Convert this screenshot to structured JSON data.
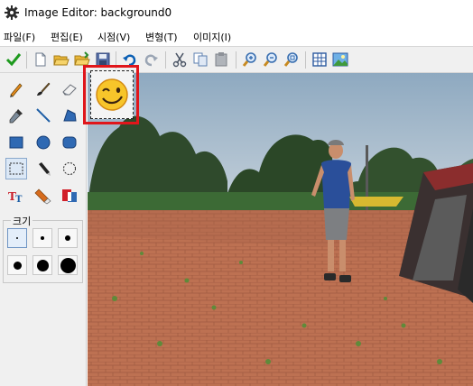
{
  "window": {
    "title": "Image Editor: background0",
    "app_icon": "gear-icon"
  },
  "menu": [
    {
      "label": "파일(F)"
    },
    {
      "label": "편집(E)"
    },
    {
      "label": "시점(V)"
    },
    {
      "label": "변형(T)"
    },
    {
      "label": "이미지(I)"
    }
  ],
  "toolbar": [
    "check-icon",
    "new-file-icon",
    "open-folder-icon",
    "open-folder-2-icon",
    "save-icon",
    "undo-icon",
    "redo-icon",
    "cut-icon",
    "copy-icon",
    "paste-icon",
    "zoom-in-icon",
    "zoom-out-icon",
    "zoom-fit-icon",
    "grid-icon",
    "image-icon"
  ],
  "tools": [
    "pencil",
    "brush",
    "eraser",
    "color-picker",
    "line",
    "fill-shape",
    "rectangle",
    "ellipse",
    "rounded-rect",
    "rect-select",
    "dropper-pen",
    "ellipse-select",
    "text",
    "clone-stamp",
    "color-swap"
  ],
  "size_panel": {
    "label": "크기",
    "sizes": [
      "1",
      "2",
      "3",
      "4",
      "5",
      "6"
    ],
    "selected_index": 0
  },
  "canvas": {
    "sticker": "winking-smiley-emoji",
    "background_scene": "outdoor brick plaza with a man walking, trees and camping tent"
  },
  "colors": {
    "selection_highlight": "#e0161b",
    "accent": "#0a5fb4"
  }
}
